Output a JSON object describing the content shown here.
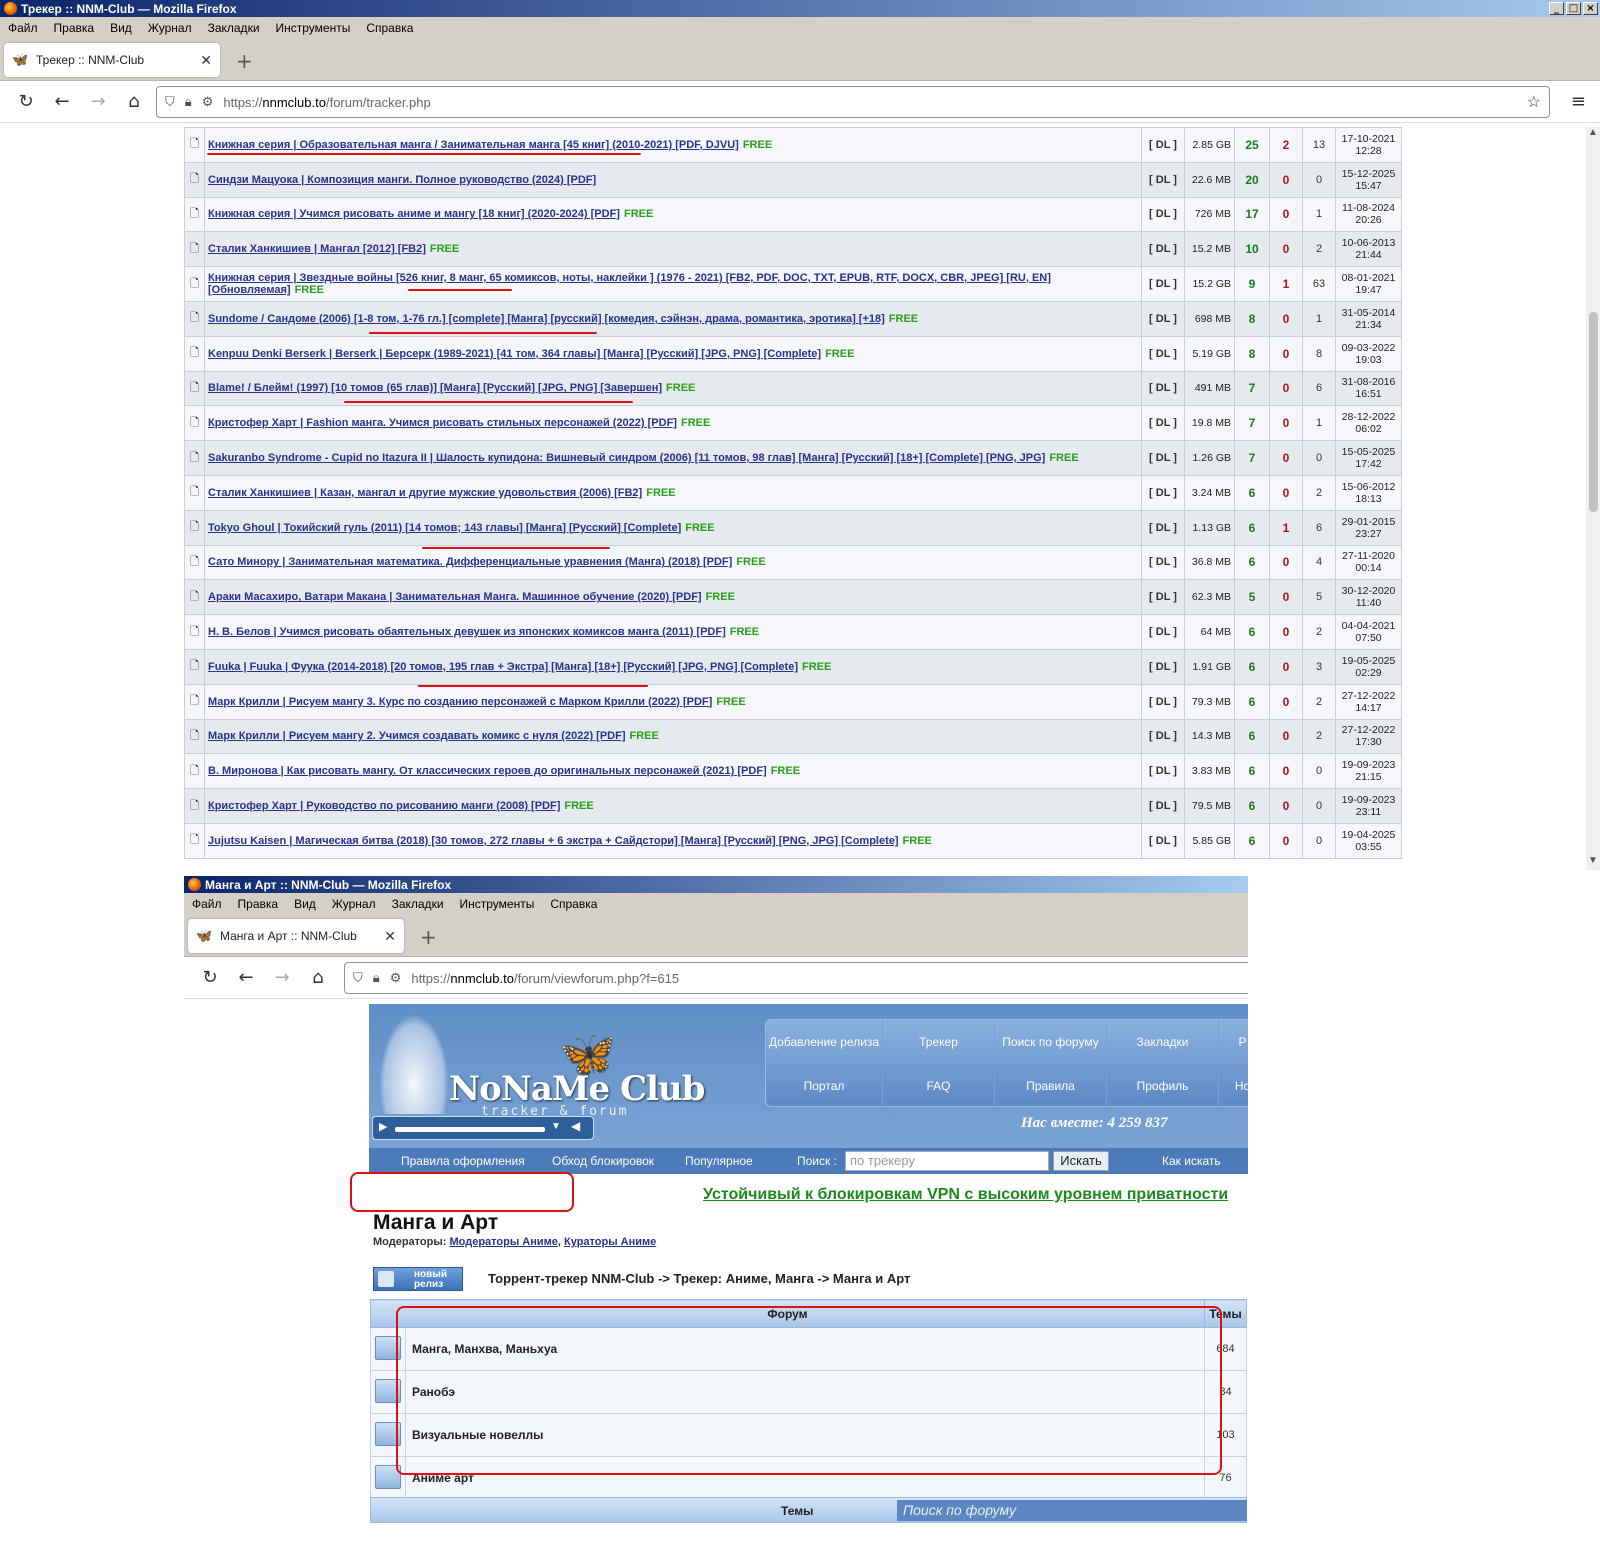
{
  "window1": {
    "title": "Трекер :: NNM-Club — Mozilla Firefox",
    "menu": [
      "Файл",
      "Правка",
      "Вид",
      "Журнал",
      "Закладки",
      "Инструменты",
      "Справка"
    ],
    "tab_title": "Трекер :: NNM-Club",
    "url_prefix": "https://",
    "url_host": "nnmclub.to",
    "url_path": "/forum/tracker.php",
    "rows": [
      {
        "title": "Книжная серия | Образовательная манга / Занимательная манга [45 книг] (2010-2021) [PDF, DJVU]",
        "free": "FREE",
        "dl": "[ DL ]",
        "size": "2.85 GB",
        "seeds": "25",
        "leech": "2",
        "comments": "13",
        "date": "17-10-2021",
        "time": "12:28"
      },
      {
        "title": "Синдзи Мацуока | Композиция манги. Полное руководство (2024) [PDF]",
        "free": "",
        "dl": "[ DL ]",
        "size": "22.6 MB",
        "seeds": "20",
        "leech": "0",
        "comments": "0",
        "date": "15-12-2025",
        "time": "15:47"
      },
      {
        "title": "Книжная серия | Учимся рисовать аниме и мангу [18 книг] (2020-2024) [PDF]",
        "free": "FREE",
        "dl": "[ DL ]",
        "size": "726 MB",
        "seeds": "17",
        "leech": "0",
        "comments": "1",
        "date": "11-08-2024",
        "time": "20:26"
      },
      {
        "title": "Сталик Ханкишиев | Мангал [2012] [FB2]",
        "free": "FREE",
        "dl": "[ DL ]",
        "size": "15.2 MB",
        "seeds": "10",
        "leech": "0",
        "comments": "2",
        "date": "10-06-2013",
        "time": "21:44"
      },
      {
        "title": "Книжная серия | Звездные войны [526 книг, 8 манг, 65 комиксов, ноты, наклейки ] (1976 - 2021) [FB2, PDF, DOC, TXT, EPUB, RTF, DOCX, CBR, JPEG] [RU, EN] [Обновляемая]",
        "free": "FREE",
        "dl": "[ DL ]",
        "size": "15.2 GB",
        "seeds": "9",
        "leech": "1",
        "comments": "63",
        "date": "08-01-2021",
        "time": "19:47"
      },
      {
        "title": "Sundome / Сандоме (2006) [1-8 том, 1-76 гл.] [complete] [Манга] [русский] [комедия, сэйнэн, драма, романтика, эротика] [+18]",
        "free": "FREE",
        "dl": "[ DL ]",
        "size": "698 MB",
        "seeds": "8",
        "leech": "0",
        "comments": "1",
        "date": "31-05-2014",
        "time": "21:34"
      },
      {
        "title": "Kenpuu Denki Berserk | Berserk | Берсерк (1989-2021) [41 том, 364 главы] [Манга] [Русский] [JPG, PNG] [Complete]",
        "free": "FREE",
        "dl": "[ DL ]",
        "size": "5.19 GB",
        "seeds": "8",
        "leech": "0",
        "comments": "8",
        "date": "09-03-2022",
        "time": "19:03"
      },
      {
        "title": "Blame! / Блейм! (1997) [10 томов (65 глав)] [Манга] [Русский] [JPG, PNG] [Завершен]",
        "free": "FREE",
        "dl": "[ DL ]",
        "size": "491 MB",
        "seeds": "7",
        "leech": "0",
        "comments": "6",
        "date": "31-08-2016",
        "time": "16:51"
      },
      {
        "title": "Кристофер Харт | Fashion манга. Учимся рисовать стильных персонажей (2022) [PDF]",
        "free": "FREE",
        "dl": "[ DL ]",
        "size": "19.8 MB",
        "seeds": "7",
        "leech": "0",
        "comments": "1",
        "date": "28-12-2022",
        "time": "06:02"
      },
      {
        "title": "Sakuranbo Syndrome - Cupid no Itazura II | Шалость купидона: Вишневый синдром (2006) [11 томов, 98 глав] [Манга] [Русский] [18+] [Complete] [PNG, JPG]",
        "free": "FREE",
        "dl": "[ DL ]",
        "size": "1.26 GB",
        "seeds": "7",
        "leech": "0",
        "comments": "0",
        "date": "15-05-2025",
        "time": "17:42"
      },
      {
        "title": "Сталик Ханкишиев | Казан, мангал и другие мужские удовольствия (2006) [FB2]",
        "free": "FREE",
        "dl": "[ DL ]",
        "size": "3.24 MB",
        "seeds": "6",
        "leech": "0",
        "comments": "2",
        "date": "15-06-2012",
        "time": "18:13"
      },
      {
        "title": "Tokyo Ghoul | Токийский гуль (2011) [14 томов; 143 главы] [Манга] [Русский] [Complete]",
        "free": "FREE",
        "dl": "[ DL ]",
        "size": "1.13 GB",
        "seeds": "6",
        "leech": "1",
        "comments": "6",
        "date": "29-01-2015",
        "time": "23:27"
      },
      {
        "title": "Сато Минору | Занимательная математика. Дифференциальные уравнения (Манга) (2018) [PDF]",
        "free": "FREE",
        "dl": "[ DL ]",
        "size": "36.8 MB",
        "seeds": "6",
        "leech": "0",
        "comments": "4",
        "date": "27-11-2020",
        "time": "00:14"
      },
      {
        "title": "Араки Масахиро, Ватари Макана | Занимательная Манга. Машинное обучение (2020) [PDF]",
        "free": "FREE",
        "dl": "[ DL ]",
        "size": "62.3 MB",
        "seeds": "5",
        "leech": "0",
        "comments": "5",
        "date": "30-12-2020",
        "time": "11:40"
      },
      {
        "title": "Н. В. Белов | Учимся рисовать обаятельных девушек из японских комиксов манга (2011) [PDF]",
        "free": "FREE",
        "dl": "[ DL ]",
        "size": "64 MB",
        "seeds": "6",
        "leech": "0",
        "comments": "2",
        "date": "04-04-2021",
        "time": "07:50"
      },
      {
        "title": "Fuuka | Fuuka | Фуука (2014-2018) [20 томов, 195 глав + Экстра] [Манга] [18+] [Русский] [JPG, PNG] [Complete]",
        "free": "FREE",
        "dl": "[ DL ]",
        "size": "1.91 GB",
        "seeds": "6",
        "leech": "0",
        "comments": "3",
        "date": "19-05-2025",
        "time": "02:29"
      },
      {
        "title": "Марк Крилли | Рисуем мангу 3. Курс по созданию персонажей с Марком Крилли (2022) [PDF]",
        "free": "FREE",
        "dl": "[ DL ]",
        "size": "79.3 MB",
        "seeds": "6",
        "leech": "0",
        "comments": "2",
        "date": "27-12-2022",
        "time": "14:17"
      },
      {
        "title": "Марк Крилли | Рисуем мангу 2. Учимся создавать комикс с нуля (2022) [PDF]",
        "free": "FREE",
        "dl": "[ DL ]",
        "size": "14.3 MB",
        "seeds": "6",
        "leech": "0",
        "comments": "2",
        "date": "27-12-2022",
        "time": "17:30"
      },
      {
        "title": "В. Миронова | Как рисовать мангу. От классических героев до оригинальных персонажей (2021) [PDF]",
        "free": "FREE",
        "dl": "[ DL ]",
        "size": "3.83 MB",
        "seeds": "6",
        "leech": "0",
        "comments": "0",
        "date": "19-09-2023",
        "time": "21:15"
      },
      {
        "title": "Кристофер Харт | Руководство по рисованию манги (2008) [PDF]",
        "free": "FREE",
        "dl": "[ DL ]",
        "size": "79.5 MB",
        "seeds": "6",
        "leech": "0",
        "comments": "0",
        "date": "19-09-2023",
        "time": "23:11"
      },
      {
        "title": "Jujutsu Kaisen | Магическая битва (2018) [30 томов, 272 главы + 6 экстра + Сайдстори] [Манга] [Русский] [PNG, JPG] [Complete]",
        "free": "FREE",
        "dl": "[ DL ]",
        "size": "5.85 GB",
        "seeds": "6",
        "leech": "0",
        "comments": "0",
        "date": "19-04-2025",
        "time": "03:55"
      }
    ]
  },
  "window2": {
    "title": "Манга и Арт :: NNM-Club — Mozilla Firefox",
    "menu": [
      "Файл",
      "Правка",
      "Вид",
      "Журнал",
      "Закладки",
      "Инструменты",
      "Справка"
    ],
    "tab_title": "Манга и Арт :: NNM-Club",
    "url_prefix": "https://",
    "url_host": "nnmclub.to",
    "url_path": "/forum/viewforum.php?f=615",
    "logo": "NoNaMe Club",
    "logo_sub": "tracker & forum",
    "nav_top": [
      "Добавление релиза",
      "Трекер",
      "Поиск по форуму",
      "Закладки",
      "Р"
    ],
    "nav_bottom": [
      "Портал",
      "FAQ",
      "Правила",
      "Профиль",
      "Но"
    ],
    "together": "Нас вместе: 4 259 837",
    "subnav": {
      "rules": "Правила оформления",
      "bypass": "Обход блокировок",
      "popular": "Популярное",
      "search_label": "Поиск :",
      "search_placeholder": "по трекеру",
      "search_btn": "Искать",
      "how": "Как искать"
    },
    "vpn": "Устойчивый к блокировкам VPN с высоким уровнем приватности",
    "forum_title": "Манга и Арт",
    "mods_label": "Модераторы:",
    "mods": [
      "Модераторы Аниме",
      "Кураторы Аниме"
    ],
    "new_release": "новый релиз",
    "breadcrumb": "Торрент-трекер NNM-Club -> Трекер: Аниме, Манга -> Манга и Арт",
    "table_headers": {
      "forum": "Форум",
      "topics": "Темы"
    },
    "subforums": [
      {
        "name": "Манга, Манхва, Маньхуа",
        "count": "684"
      },
      {
        "name": "Ранобэ",
        "count": "84"
      },
      {
        "name": "Визуальные новеллы",
        "count": "103"
      },
      {
        "name": "Аниме арт",
        "count": "76"
      }
    ],
    "topics_label": "Темы",
    "forum_search_placeholder": "Поиск по форуму"
  }
}
